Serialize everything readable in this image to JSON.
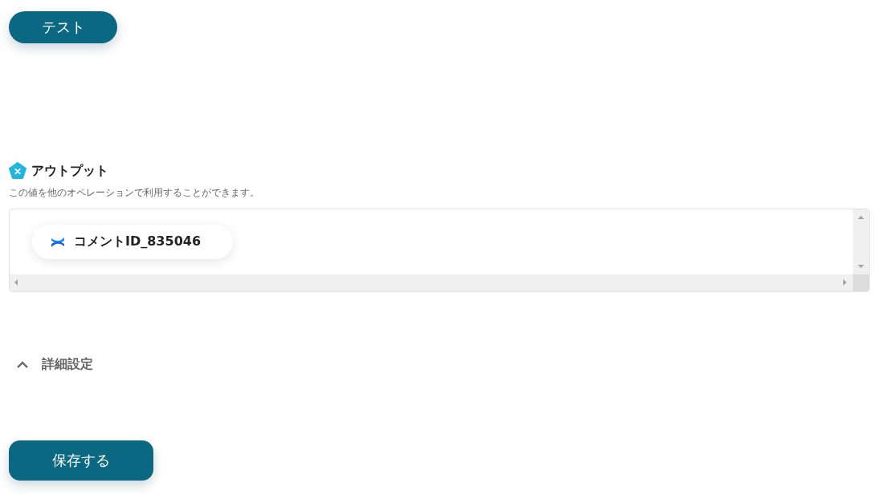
{
  "test_button": "テスト",
  "output": {
    "title": "アウトプット",
    "description": "この値を他のオペレーションで利用することができます。",
    "items": [
      {
        "label": "コメントID_835046"
      }
    ]
  },
  "advanced": {
    "label": "詳細設定",
    "expanded": true
  },
  "save_button": "保存する"
}
